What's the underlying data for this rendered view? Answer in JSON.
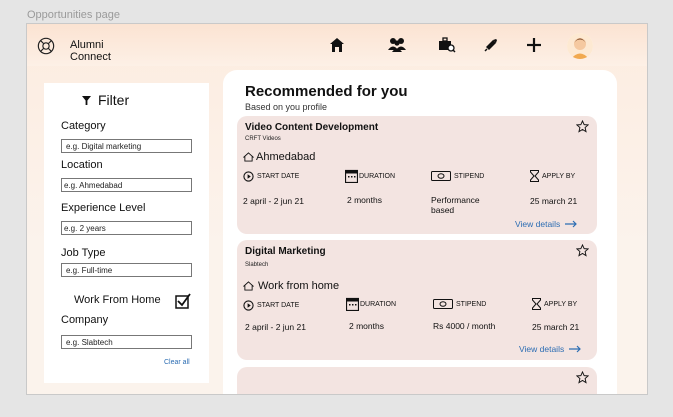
{
  "page_label": "Opportunities page",
  "brand": {
    "line1": "Alumni",
    "line2": "Connect"
  },
  "nav_icons": [
    "home-icon",
    "people-icon",
    "job-search-icon",
    "announcement-icon",
    "plus-icon",
    "profile-avatar"
  ],
  "filter": {
    "title": "Filter",
    "category": {
      "label": "Category",
      "placeholder": "e.g. Digital marketing"
    },
    "location": {
      "label": "Location",
      "placeholder": "e.g. Ahmedabad"
    },
    "experience": {
      "label": "Experience Level",
      "placeholder": "e.g. 2 years"
    },
    "job_type": {
      "label": "Job Type",
      "placeholder": "e.g. Full-time"
    },
    "wfh": {
      "label": "Work From Home",
      "checked": true
    },
    "company": {
      "label": "Company",
      "placeholder": "e.g. Slabtech"
    },
    "clear_all": "Clear all"
  },
  "recommended": {
    "title": "Recommended for you",
    "subtitle": "Based on you profile",
    "headings": {
      "start_date": "START DATE",
      "duration": "DURATION",
      "stipend": "STIPEND",
      "apply_by": "APPLY BY"
    },
    "cards": [
      {
        "title": "Video Content Development",
        "company": "CRFT Videos",
        "location": "Ahmedabad",
        "start_date": "2 april - 2 jun 21",
        "duration": "2 months",
        "stipend": "Performance based",
        "apply_by": "25 march 21",
        "view": "View details"
      },
      {
        "title": "Digital Marketing",
        "company": "Slabtech",
        "location": "Work from home",
        "start_date": "2 april - 2 jun 21",
        "duration": "2 months",
        "stipend": "Rs 4000 / month",
        "apply_by": "25 march 21",
        "view": "View details"
      }
    ]
  }
}
